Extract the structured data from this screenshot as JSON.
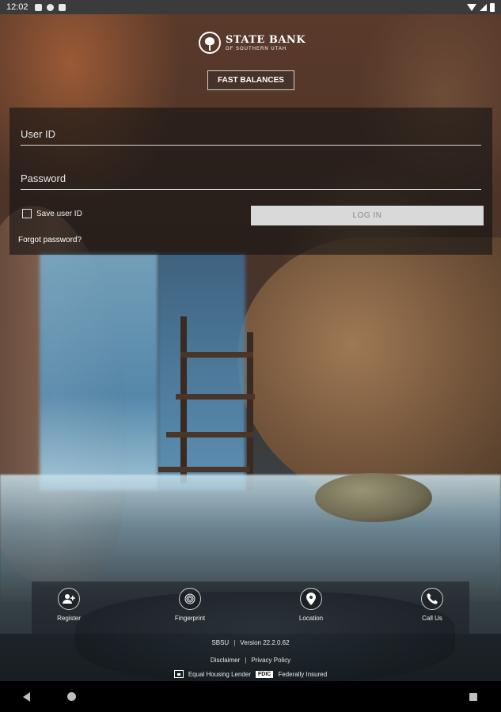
{
  "status_bar": {
    "time": "12:02",
    "icons": [
      "notification-icon",
      "location-app-icon",
      "sim-icon"
    ],
    "right_icons": [
      "wifi-icon",
      "signal-icon",
      "battery-icon"
    ]
  },
  "header": {
    "bank_name": "STATE BANK",
    "bank_subtitle": "OF SOUTHERN UTAH",
    "fast_balances_label": "FAST BALANCES"
  },
  "login": {
    "user_id_placeholder": "User ID",
    "password_placeholder": "Password",
    "save_user_id_label": "Save user ID",
    "save_user_id_checked": false,
    "login_button_label": "LOG IN",
    "forgot_password_label": "Forgot password?"
  },
  "actions": [
    {
      "label": "Register",
      "icon": "add-person-icon"
    },
    {
      "label": "Fingerprint",
      "icon": "fingerprint-icon"
    },
    {
      "label": "Location",
      "icon": "location-pin-icon"
    },
    {
      "label": "Call Us",
      "icon": "phone-icon"
    }
  ],
  "footer": {
    "app_name": "SBSU",
    "version": "Version 22.2.0.62",
    "disclaimer": "Disclaimer",
    "privacy_policy": "Privacy Policy",
    "equal_housing": "Equal Housing Lender",
    "fdic_badge": "FDIC",
    "federally_insured": "Federally Insured"
  },
  "nav_bar": {
    "icons": [
      "back-icon",
      "home-icon",
      "recent-apps-icon"
    ]
  }
}
